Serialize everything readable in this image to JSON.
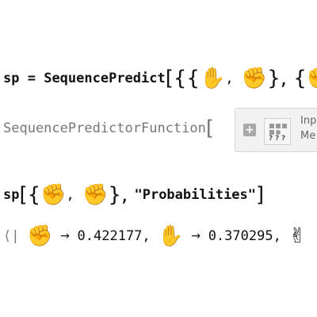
{
  "line1": {
    "var": "sp",
    "eq": " = ",
    "func": "SequencePredict",
    "open": "[{{",
    "sep": ", ",
    "tail": "}, {"
  },
  "line2": {
    "head": "SequencePredictorFunction",
    "bracket": "[",
    "panel_labels": [
      "Inp",
      "Me"
    ]
  },
  "line3": {
    "var": "sp",
    "open": "[{",
    "sep": ", ",
    "close": "}, ",
    "prop": "\"Probabilities\"",
    "end": "]"
  },
  "line4": {
    "open": "⟨",
    "bar": "|",
    "arrow": "→",
    "val1": "0.422177,",
    "val2": "0.370295,"
  },
  "icons": {
    "paper": "✋",
    "rock": "✊",
    "scissors": "✌"
  }
}
